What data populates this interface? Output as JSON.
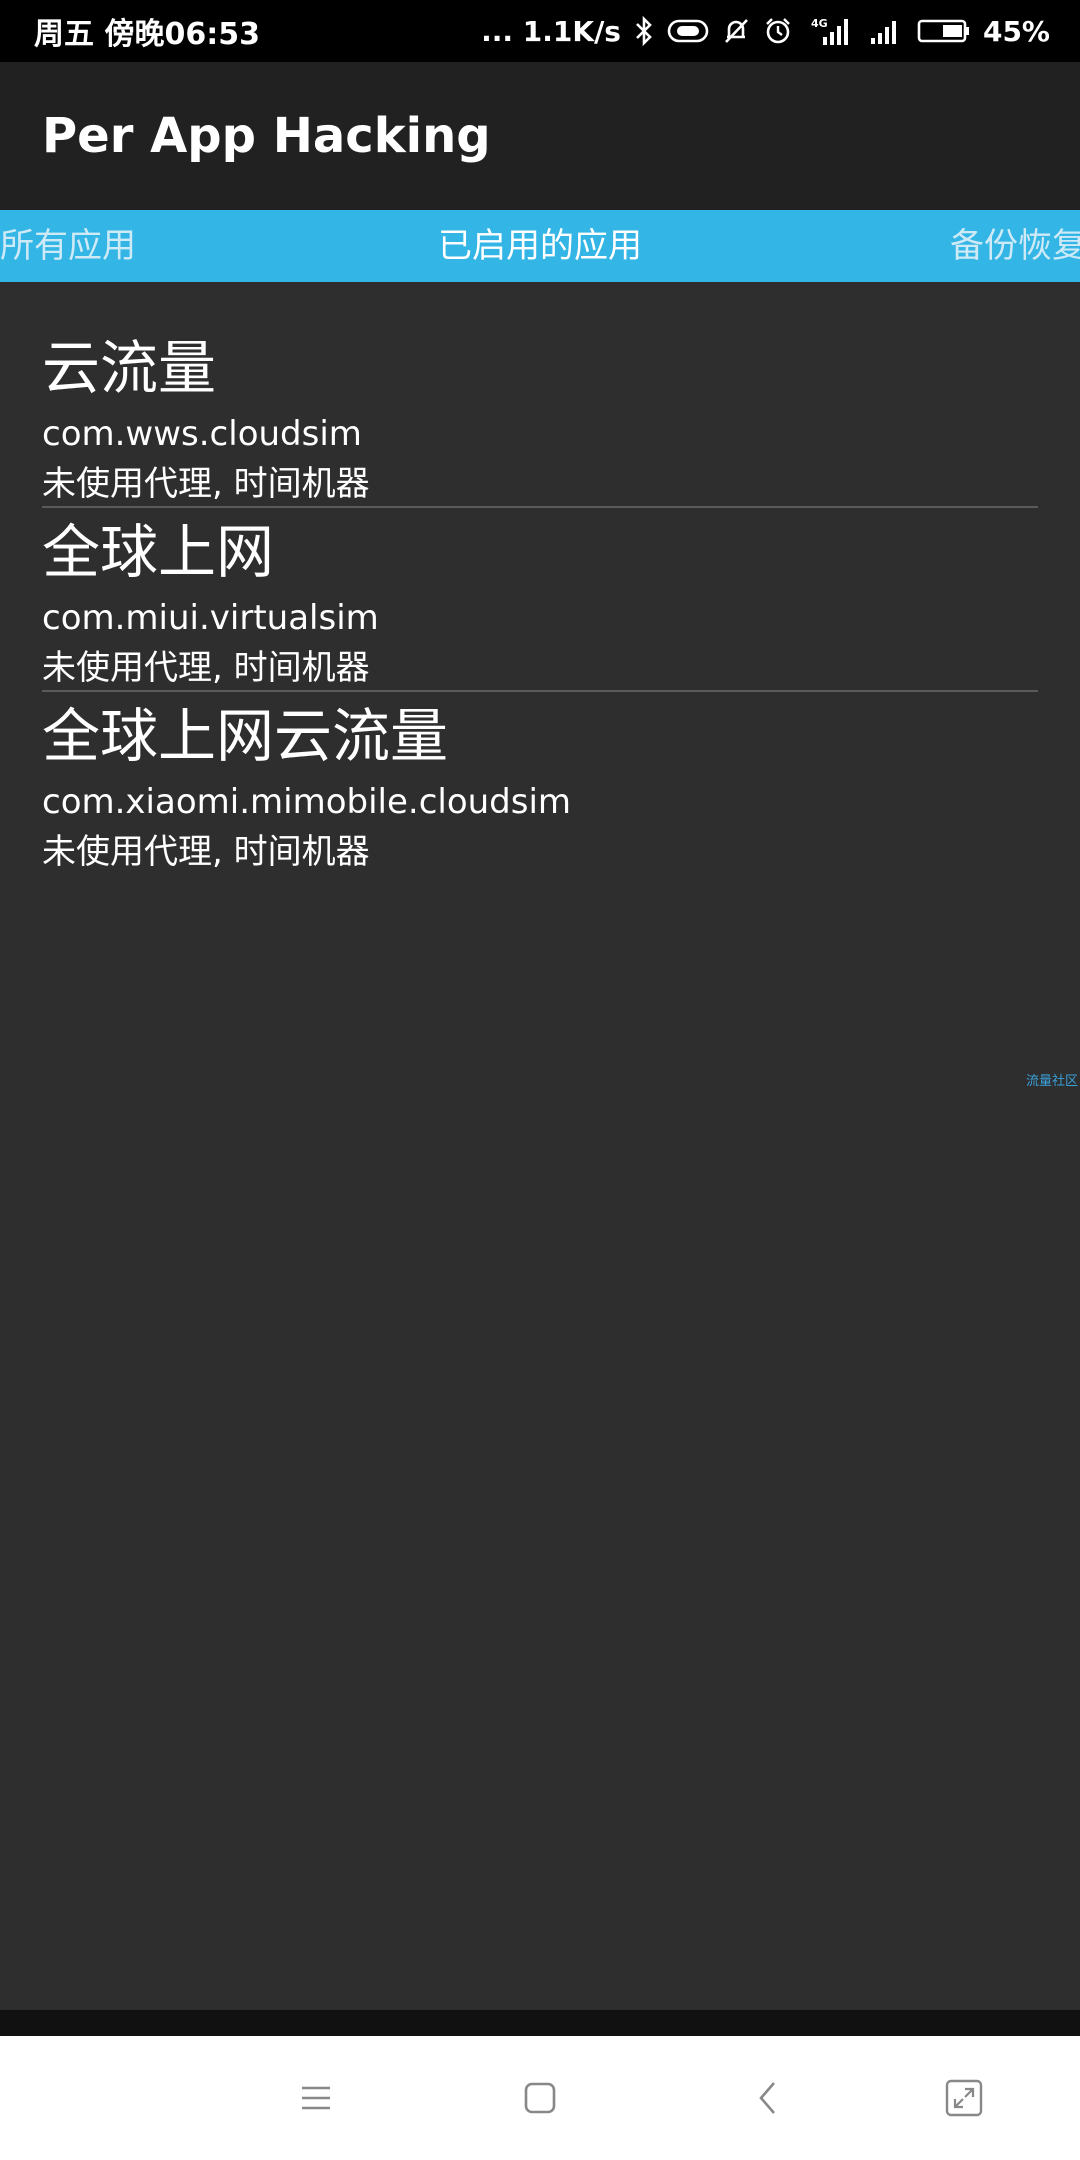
{
  "status_bar": {
    "time": "周五 傍晚06:53",
    "speed": "... 1.1K/s",
    "network": "4G",
    "battery": "45%",
    "icons": [
      "bluetooth-icon",
      "hd-voice-icon",
      "silent-icon",
      "alarm-icon",
      "signal-4g-icon",
      "signal-icon",
      "battery-icon"
    ]
  },
  "app_bar": {
    "title": "Per App Hacking"
  },
  "tabs": {
    "all": "所有应用",
    "enabled": "已启用的应用",
    "backup": "备份恢复",
    "accent_color": "#33b5e5"
  },
  "apps": [
    {
      "name": "云流量",
      "package": "com.wws.cloudsim",
      "status": "未使用代理, 时间机器"
    },
    {
      "name": "全球上网",
      "package": "com.miui.virtualsim",
      "status": "未使用代理, 时间机器"
    },
    {
      "name": "全球上网云流量",
      "package": "com.xiaomi.mimobile.cloudsim",
      "status": "未使用代理, 时间机器"
    }
  ],
  "watermark": "流量社区",
  "nav_bar": {
    "icons": [
      "menu-icon",
      "home-icon",
      "back-icon",
      "expand-icon"
    ]
  }
}
